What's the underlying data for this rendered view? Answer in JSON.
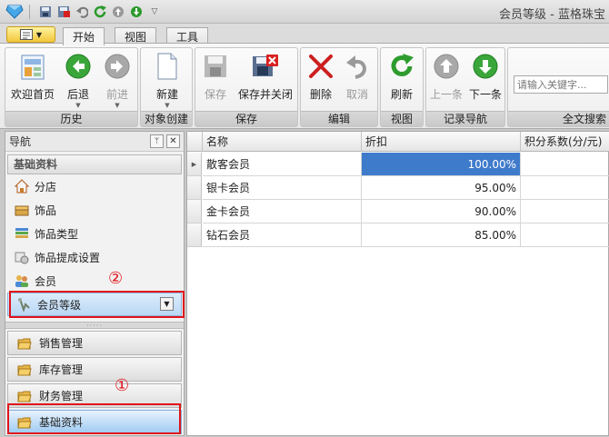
{
  "window": {
    "title": "会员等级 - 蓝格珠宝"
  },
  "quick_access": [
    "save-icon",
    "save-close-icon",
    "undo-icon",
    "refresh-icon",
    "up-icon",
    "down-icon",
    "customize-icon"
  ],
  "tabs": [
    {
      "label": "开始",
      "active": true
    },
    {
      "label": "视图",
      "active": false
    },
    {
      "label": "工具",
      "active": false
    }
  ],
  "ribbon": {
    "groups": {
      "history": "历史",
      "object_create": "对象创建",
      "save": "保存",
      "edit": "编辑",
      "view": "视图",
      "record_nav": "记录导航",
      "fulltext": "全文搜索"
    },
    "buttons": {
      "home": "欢迎首页",
      "back": "后退",
      "forward": "前进",
      "new": "新建",
      "save": "保存",
      "save_close": "保存并关闭",
      "delete": "删除",
      "cancel": "取消",
      "refresh": "刷新",
      "prev": "上一条",
      "next": "下一条"
    },
    "search_placeholder": "请输入关键字..."
  },
  "nav": {
    "title": "导航",
    "pin": "ᛘ",
    "close": "✕",
    "section": "基础资料",
    "items": [
      {
        "label": "分店",
        "icon": "house-icon"
      },
      {
        "label": "饰品",
        "icon": "box-icon"
      },
      {
        "label": "饰品类型",
        "icon": "layers-icon"
      },
      {
        "label": "饰品提成设置",
        "icon": "settings-icon"
      },
      {
        "label": "会员",
        "icon": "users-icon"
      },
      {
        "label": "会员等级",
        "icon": "member-level-icon",
        "selected": true
      }
    ],
    "categories": [
      {
        "label": "销售管理"
      },
      {
        "label": "库存管理"
      },
      {
        "label": "财务管理"
      },
      {
        "label": "基础资料",
        "selected": true
      }
    ],
    "splitter": "·····"
  },
  "annotations": {
    "marker1": "①",
    "marker2": "②",
    "color": "#e0131a"
  },
  "grid": {
    "columns": [
      "名称",
      "折扣",
      "积分系数(分/元)"
    ],
    "rows": [
      {
        "name": "散客会员",
        "discount": "100.00%",
        "selected": true
      },
      {
        "name": "银卡会员",
        "discount": "95.00%"
      },
      {
        "name": "金卡会员",
        "discount": "90.00%"
      },
      {
        "name": "钻石会员",
        "discount": "85.00%"
      }
    ],
    "selection_color": "#3f7bcb"
  }
}
